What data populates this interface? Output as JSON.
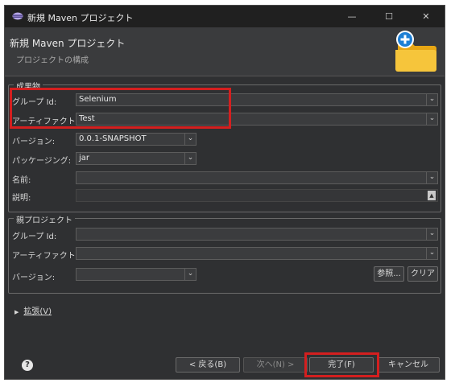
{
  "window": {
    "title": "新規 Maven プロジェクト",
    "minimize": "—",
    "maximize": "☐",
    "close": "✕"
  },
  "header": {
    "title": "新規 Maven プロジェクト",
    "subtitle": "プロジェクトの構成"
  },
  "artifact": {
    "legend": "成果物",
    "group_id_label": "グループ Id:",
    "group_id_value": "Selenium",
    "artifact_id_label": "アーティファクト Id:",
    "artifact_id_value": "Test",
    "version_label": "バージョン:",
    "version_value": "0.0.1-SNAPSHOT",
    "packaging_label": "パッケージング:",
    "packaging_value": "jar",
    "name_label": "名前:",
    "name_value": "",
    "description_label": "説明:",
    "description_value": ""
  },
  "parent": {
    "legend": "親プロジェクト",
    "group_id_label": "グループ Id:",
    "group_id_value": "",
    "artifact_id_label": "アーティファクト Id:",
    "artifact_id_value": "",
    "version_label": "バージョン:",
    "version_value": "",
    "browse_label": "参照...",
    "clear_label": "クリア"
  },
  "advanced": {
    "label": "拡張(V)"
  },
  "footer": {
    "help": "?",
    "back_label": "< 戻る(B)",
    "next_label": "次へ(N) >",
    "finish_label": "完了(F)",
    "cancel_label": "キャンセル"
  },
  "colors": {
    "highlight": "#d41f1f",
    "window_bg": "#2f3032",
    "titlebar_bg": "#202020"
  }
}
